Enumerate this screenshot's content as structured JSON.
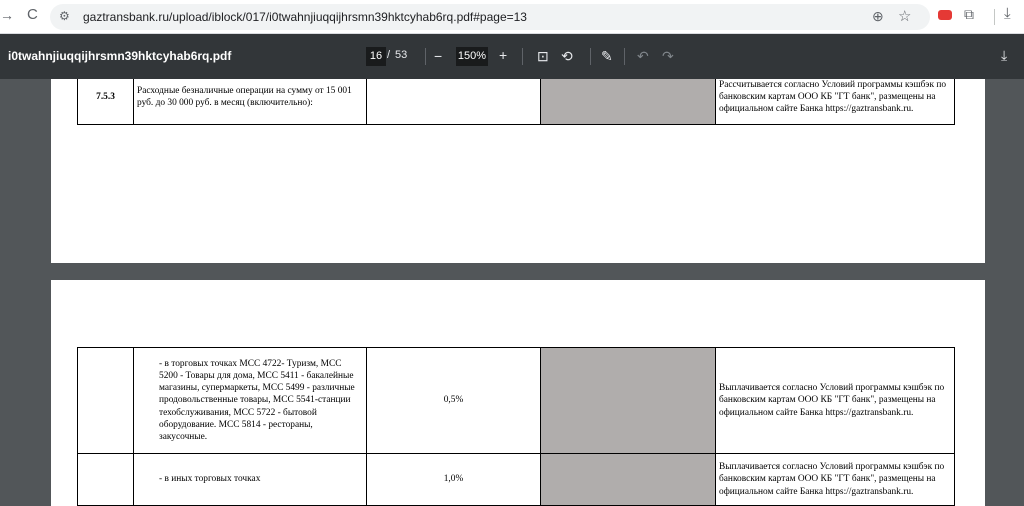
{
  "browser": {
    "back_glyph": "→",
    "reload_glyph": "C",
    "site_info_glyph": "⚙",
    "url": "gaztransbank.ru/upload/iblock/017/i0twahnjiuqqijhrsmn39hktcyhab6rq.pdf#page=13",
    "zoom_glyph": "⊕",
    "star_glyph": "☆",
    "puzzle_glyph": "⧉",
    "download_glyph": "⤓",
    "icons": [
      "forward-icon",
      "reload-icon",
      "site-info-icon",
      "zoom-icon",
      "bookmark-star-icon",
      "youtube-extension-icon",
      "extensions-icon",
      "download-icon"
    ]
  },
  "pdf_toolbar": {
    "filename": "i0twahnjiuqqijhrsmn39hktcyhab6rq.pdf",
    "current_page": "16",
    "page_separator": "/",
    "total_pages": "53",
    "zoom_out": "−",
    "zoom": "150%",
    "zoom_in": "+",
    "fit_glyph": "⊡",
    "rotate_glyph": "⟲",
    "annotate_glyph": "✎",
    "undo_glyph": "↶",
    "redo_glyph": "↷",
    "download_glyph": "⤓"
  },
  "page_top": {
    "row": {
      "num": "7.5.3",
      "desc": "Расходные безналичные операции на сумму от 15 001 руб. до 30 000 руб. в месяц (включительно):",
      "rate": "",
      "note": "Рассчитывается согласно Условий программы кэшбэк по банковским картам ООО КБ \"ГТ банк\", размещены на официальном сайте Банка https://gaztransbank.ru."
    }
  },
  "page_bottom": {
    "rows": [
      {
        "num": "",
        "desc": "- в торговых точках  МСС 4722- Туризм, МСС 5200 - Товары для дома, МСС 5411 - бакалейные магазины, супермаркеты, МСС 5499 - различные продовольственные товары, МСС 5541-станции техобслуживания, МСС 5722 - бытовой оборудование. МСС 5814 - рестораны, закусочные.",
        "rate": "0,5%",
        "note": "Выплачивается согласно Условий программы кэшбэк по банковским картам ООО КБ \"ГТ банк\", размещены на официальном сайте Банка https://gaztransbank.ru."
      },
      {
        "num": "",
        "desc": "- в иных торговых точках",
        "rate": "1,0%",
        "note": "Выплачивается согласно Условий программы кэшбэк по банковским картам ООО КБ \"ГТ банк\", размещены на официальном сайте Банка https://gaztransbank.ru."
      }
    ]
  },
  "colors": {
    "toolbar_bg": "#323639",
    "viewer_bg": "#525659",
    "gray_cell": "#b0adac"
  }
}
